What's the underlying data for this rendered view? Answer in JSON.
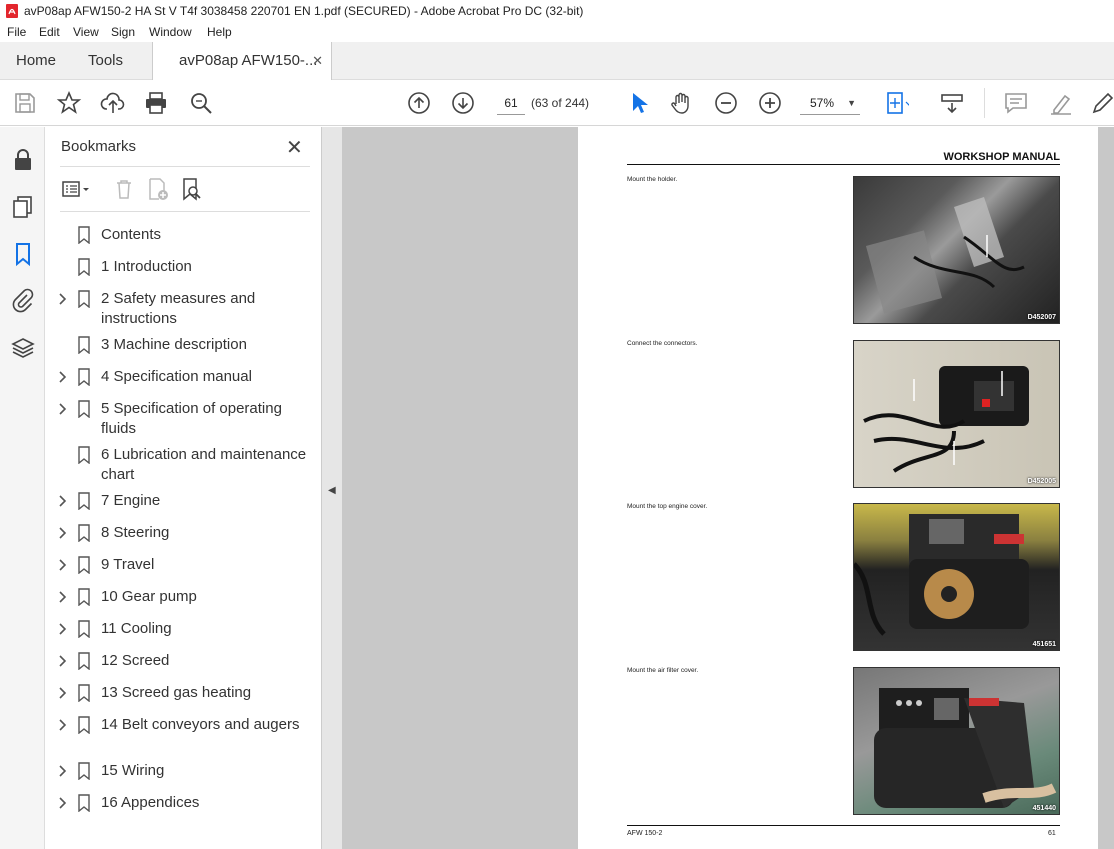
{
  "window": {
    "title": "avP08ap AFW150-2 HA St V T4f 3038458 220701 EN 1.pdf (SECURED) - Adobe Acrobat Pro DC (32-bit)"
  },
  "menu": [
    "File",
    "Edit",
    "View",
    "Sign",
    "Window",
    "Help"
  ],
  "tabs": {
    "home": "Home",
    "tools": "Tools",
    "document": "avP08ap AFW150-..."
  },
  "toolbar": {
    "page_current": "61",
    "page_count": "(63 of 244)",
    "zoom": "57%",
    "icons": [
      "save-icon",
      "star-icon",
      "upload-icon",
      "print-icon",
      "find-icon",
      "page-up-icon",
      "page-down-icon",
      "select-cursor-icon",
      "hand-tool-icon",
      "zoom-out-icon",
      "zoom-in-icon",
      "fit-page-icon",
      "scroll-mode-icon",
      "comment-icon",
      "highlight-icon",
      "sign-icon"
    ]
  },
  "bookmarks": {
    "title": "Bookmarks",
    "items": [
      {
        "label": "Contents",
        "expandable": false
      },
      {
        "label": "1 Introduction",
        "expandable": false
      },
      {
        "label": "2 Safety measures and instructions",
        "expandable": true
      },
      {
        "label": "3 Machine description",
        "expandable": false
      },
      {
        "label": "4 Specification manual",
        "expandable": true
      },
      {
        "label": "5 Specification of operating fluids",
        "expandable": true
      },
      {
        "label": "6 Lubrication and maintenance chart",
        "expandable": false
      },
      {
        "label": "7 Engine",
        "expandable": true
      },
      {
        "label": "8 Steering",
        "expandable": true
      },
      {
        "label": "9 Travel",
        "expandable": true
      },
      {
        "label": "10 Gear pump",
        "expandable": true
      },
      {
        "label": "11 Cooling",
        "expandable": true
      },
      {
        "label": "12 Screed",
        "expandable": true
      },
      {
        "label": "13 Screed gas heating",
        "expandable": true
      },
      {
        "label": "14 Belt conveyors and augers",
        "expandable": true
      },
      {
        "label": "15 Wiring",
        "expandable": true
      },
      {
        "label": "16 Appendices",
        "expandable": true
      }
    ]
  },
  "document_page": {
    "header": "WORKSHOP MANUAL",
    "steps": [
      {
        "caption": "Mount the holder.",
        "image_code": "D452007"
      },
      {
        "caption": "Connect the connectors.",
        "image_code": "D452005"
      },
      {
        "caption": "Mount the top engine cover.",
        "image_code": "451651"
      },
      {
        "caption": "Mount the air filter cover.",
        "image_code": "451440"
      }
    ],
    "footer_left": "AFW 150-2",
    "footer_right": "61"
  },
  "colors": {
    "accent": "#1473e6",
    "pdf_red": "#e3262d"
  }
}
